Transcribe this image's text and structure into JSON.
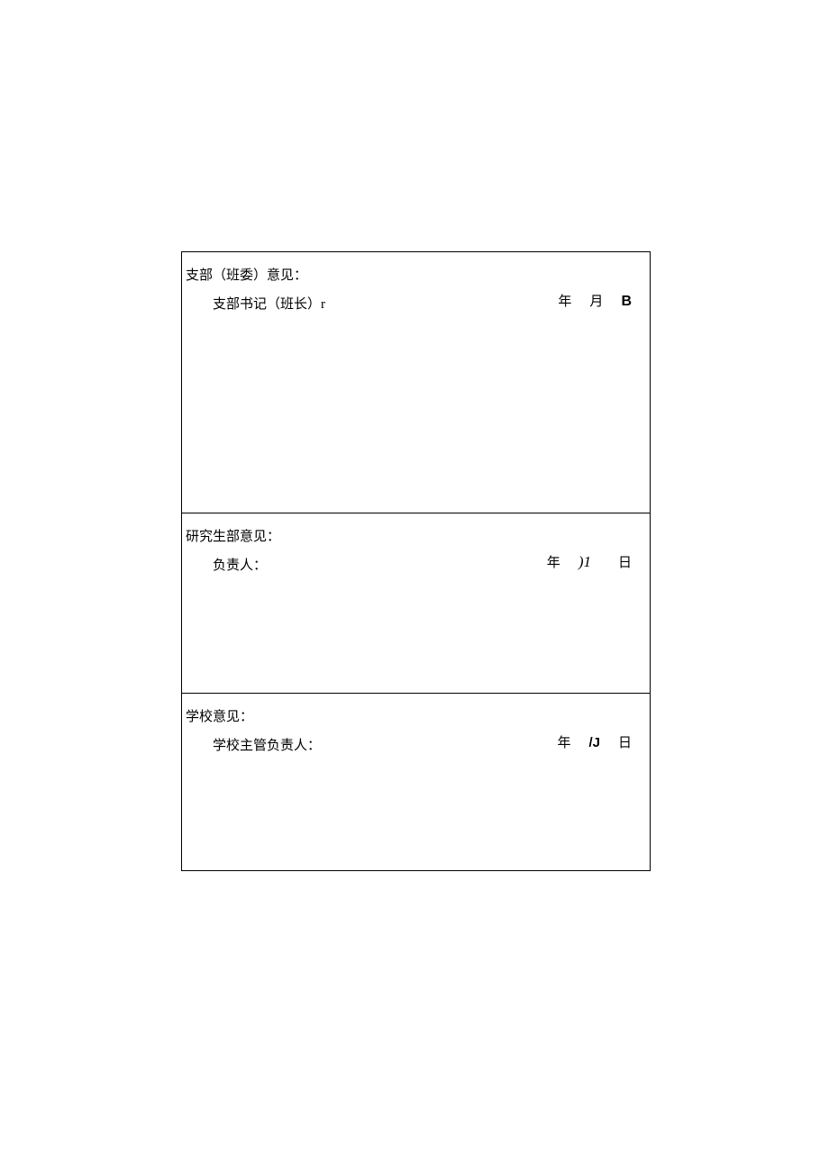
{
  "sections": [
    {
      "label": "支部（班委）意见：",
      "signer": "支部书记（班长）r",
      "year": "年",
      "month": "月",
      "day": "B",
      "day_class": "ocr-b"
    },
    {
      "label": "研究生部意见：",
      "signer": "负责人：",
      "year": "年",
      "month": ")1",
      "day": "日",
      "month_class": "ocr-italic"
    },
    {
      "label": "学校意见：",
      "signer": "学校主管负责人：",
      "year": "年",
      "month": "/J",
      "day": "日",
      "month_class": "ocr-slash"
    }
  ]
}
